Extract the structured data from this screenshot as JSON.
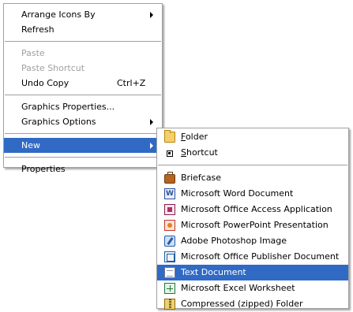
{
  "context_menu": {
    "items": [
      {
        "label": "Arrange Icons By",
        "submenu": true,
        "disabled": false
      },
      {
        "label": "Refresh",
        "submenu": false,
        "disabled": false
      },
      {
        "separator": true
      },
      {
        "label": "Paste",
        "submenu": false,
        "disabled": true
      },
      {
        "label": "Paste Shortcut",
        "submenu": false,
        "disabled": true
      },
      {
        "label": "Undo Copy",
        "shortcut": "Ctrl+Z",
        "submenu": false,
        "disabled": false
      },
      {
        "separator": true
      },
      {
        "label": "Graphics Properties...",
        "submenu": false,
        "disabled": false
      },
      {
        "label": "Graphics Options",
        "submenu": true,
        "disabled": false
      },
      {
        "separator": true
      },
      {
        "label": "New",
        "submenu": true,
        "disabled": false,
        "highlighted": true
      },
      {
        "separator": true
      },
      {
        "label": "Properties",
        "submenu": false,
        "disabled": false
      }
    ]
  },
  "new_submenu": {
    "items": [
      {
        "label": "Folder",
        "accel": "F",
        "icon": "folder-icon"
      },
      {
        "label": "Shortcut",
        "accel": "S",
        "icon": "shortcut-icon"
      },
      {
        "separator": true
      },
      {
        "label": "Briefcase",
        "icon": "briefcase-icon"
      },
      {
        "label": "Microsoft Word Document",
        "icon": "word-document-icon"
      },
      {
        "label": "Microsoft Office Access Application",
        "icon": "access-application-icon"
      },
      {
        "label": "Microsoft PowerPoint Presentation",
        "icon": "powerpoint-presentation-icon"
      },
      {
        "label": "Adobe Photoshop Image",
        "icon": "photoshop-image-icon"
      },
      {
        "label": "Microsoft Office Publisher Document",
        "icon": "publisher-document-icon"
      },
      {
        "label": "Text Document",
        "icon": "text-document-icon",
        "highlighted": true
      },
      {
        "label": "Microsoft Excel Worksheet",
        "icon": "excel-worksheet-icon"
      },
      {
        "label": "Compressed (zipped) Folder",
        "icon": "zipped-folder-icon"
      }
    ]
  },
  "colors": {
    "highlight": "#316ac5",
    "disabled_text": "#a0a0a0",
    "menu_background": "#ffffff"
  }
}
